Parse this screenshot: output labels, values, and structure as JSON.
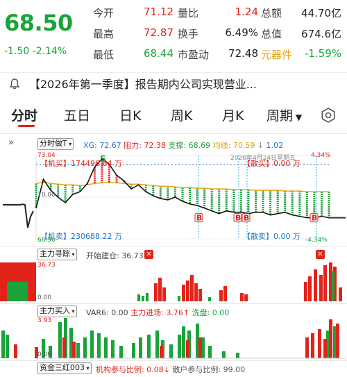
{
  "quote": {
    "price": "68.50",
    "change": "-1.50",
    "change_pct": "-2.14%",
    "rows": [
      [
        {
          "label": "今开",
          "value": "71.12"
        },
        {
          "label": "量比",
          "value": "1.24"
        },
        {
          "label": "总额",
          "value": "44.70亿"
        }
      ],
      [
        {
          "label": "最高",
          "value": "72.87"
        },
        {
          "label": "换手",
          "value": "6.49%"
        },
        {
          "label": "总值",
          "value": "674.6亿"
        }
      ],
      [
        {
          "label": "最低",
          "value": "68.44"
        },
        {
          "label": "市盈动",
          "value": "72.48"
        },
        {
          "label": "元器件",
          "value": "-1.59%"
        }
      ]
    ]
  },
  "notice": {
    "text": "【2026年第一季度】报告期内公司实现营业..."
  },
  "tabs": [
    "分时",
    "五日",
    "日K",
    "周K",
    "月K",
    "周期"
  ],
  "main_chart": {
    "indicator_name": "分时做T",
    "xg": "XG: 72.67",
    "zuli": "阻力: 72.38",
    "zhicheng": "支撑: 68.69",
    "junxian": "均线: 70.59",
    "extra": "1.02",
    "top_left_value": "73.04",
    "mid_left_value": "70.00",
    "bottom_left_value": "66.96",
    "top_right_pct": "4.34%",
    "bottom_right_pct": "-4.34%",
    "date_label": "2026年4月24日星期五",
    "jimai_label": "【机买】174496.84 万",
    "sanmai_label": "【散买】0.00 万",
    "jimai_sell_label": "【机卖】230688.22 万",
    "sanmai_sell_label": "【散卖】0.00 万",
    "s_marker": "S",
    "b_marker": "B"
  },
  "ind1": {
    "name": "主力寻踪",
    "text": "开始建仓: 36.73",
    "top": "36.73",
    "bottom": "0.00"
  },
  "ind2": {
    "name": "主力买入",
    "var6": "VAR6: 0.00",
    "jc": "主力进场: 3.76",
    "xp": "洗盘: 0.00",
    "top": "3.93",
    "bottom": "0.00"
  },
  "ind3": {
    "name": "资金三红003",
    "jg": "机构参与比例: 0.08",
    "sh": "散户参与比例: 99.00"
  },
  "colors": {
    "red": "#e2231a",
    "green": "#1aa33a",
    "orange": "#e8a318",
    "blue": "#1e73c8"
  },
  "chart_data": [
    {
      "type": "line",
      "title": "分时",
      "ylim": [
        66.96,
        73.04
      ],
      "series": [
        {
          "name": "price",
          "values": [
            69.2,
            71.3,
            70.5,
            70.0,
            69.6,
            70.2,
            70.4,
            71.0,
            72.2,
            72.8,
            72.4,
            71.6,
            71.2,
            70.6,
            70.9,
            70.4,
            70.1,
            69.9,
            69.8,
            70.0,
            69.7,
            69.5,
            69.4,
            69.2,
            69.0,
            68.8,
            69.0,
            68.9,
            68.9,
            68.8,
            68.9,
            68.9,
            68.7,
            68.8,
            68.9,
            68.7,
            68.6,
            68.5,
            68.5,
            68.6,
            68.5
          ]
        },
        {
          "name": "avg",
          "values": [
            71.0,
            71.1,
            71.0,
            70.95,
            70.9,
            70.9,
            70.85,
            70.9,
            71.0,
            71.05,
            71.05,
            71.05,
            71.0,
            70.95,
            70.95,
            70.9,
            70.85,
            70.8,
            70.8,
            70.75,
            70.7,
            70.7,
            70.65,
            70.65,
            70.6,
            70.6,
            70.6,
            70.55,
            70.55,
            70.55,
            70.5,
            70.5,
            70.5,
            70.5,
            70.45,
            70.45,
            70.45,
            70.4,
            70.4,
            70.4,
            70.4
          ]
        }
      ]
    }
  ]
}
